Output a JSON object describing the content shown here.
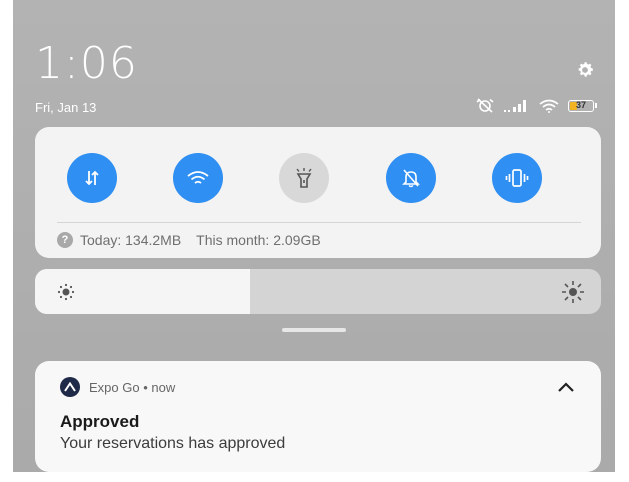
{
  "status_bar": {
    "time": "1:06",
    "date": "Fri, Jan 13",
    "battery_level": "37",
    "signal_bars_text": "..ıll"
  },
  "quick_toggles": [
    {
      "name": "mobile-data",
      "state": "on",
      "icon": "data-arrows-icon"
    },
    {
      "name": "wifi",
      "state": "on",
      "icon": "wifi-icon"
    },
    {
      "name": "flashlight",
      "state": "off",
      "icon": "flashlight-icon"
    },
    {
      "name": "silent",
      "state": "on",
      "icon": "bell-off-icon"
    },
    {
      "name": "vibrate",
      "state": "on",
      "icon": "vibrate-icon"
    }
  ],
  "data_usage": {
    "today": "Today: 134.2MB",
    "month": "This month: 2.09GB"
  },
  "brightness": {
    "level_percent": 38
  },
  "notification": {
    "app_name": "Expo Go",
    "separator": "•",
    "time": "now",
    "title": "Approved",
    "body": "Your reservations has approved"
  },
  "colors": {
    "toggle_on": "#2f8ff2",
    "toggle_off": "#d8d8d8",
    "background": "#b0b0b0",
    "battery": "#f2b323"
  }
}
